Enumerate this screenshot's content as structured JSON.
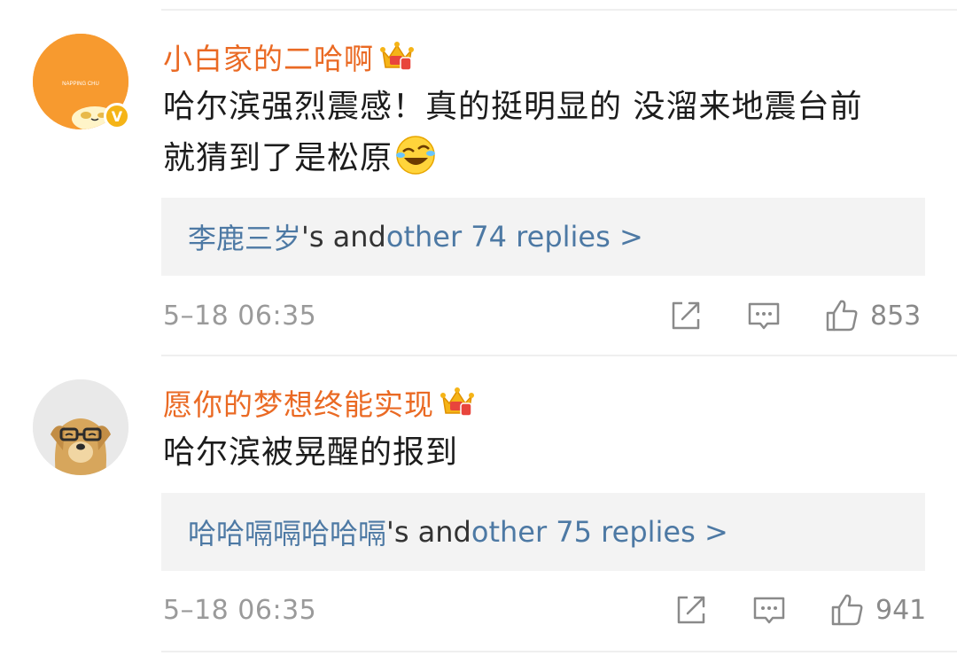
{
  "comments": [
    {
      "username": "小白家的二哈啊",
      "text_line1": "哈尔滨强烈震感！真的挺明显的 没溜来地震台前",
      "text_line2": "就猜到了是松原",
      "avatar_text": "NAPPING CHU",
      "verified_label": "V",
      "replies": {
        "first_replier": "李鹿三岁",
        "middle": "'s and ",
        "link": "other 74 replies >"
      },
      "timestamp": "5–18 06:35",
      "like_count": "853"
    },
    {
      "username": "愿你的梦想终能实现",
      "text_line1": "哈尔滨被晃醒的报到",
      "replies": {
        "first_replier": "哈哈嗝嗝哈哈嗝",
        "middle": "'s and ",
        "link": "other 75 replies >"
      },
      "timestamp": "5–18 06:35",
      "like_count": "941"
    }
  ],
  "colors": {
    "username": "#ea6a24",
    "link": "#4d79a4",
    "reply_box_bg": "#f3f3f3",
    "meta": "#9a9a9a",
    "verified_badge": "#f5b417",
    "avatar1_bg": "#f79a2f"
  },
  "icons": {
    "crown": "vip-crown-icon",
    "emoji": "laughing-crying-emoji-icon",
    "share": "share-icon",
    "comment": "comment-icon",
    "like": "thumbs-up-icon"
  }
}
